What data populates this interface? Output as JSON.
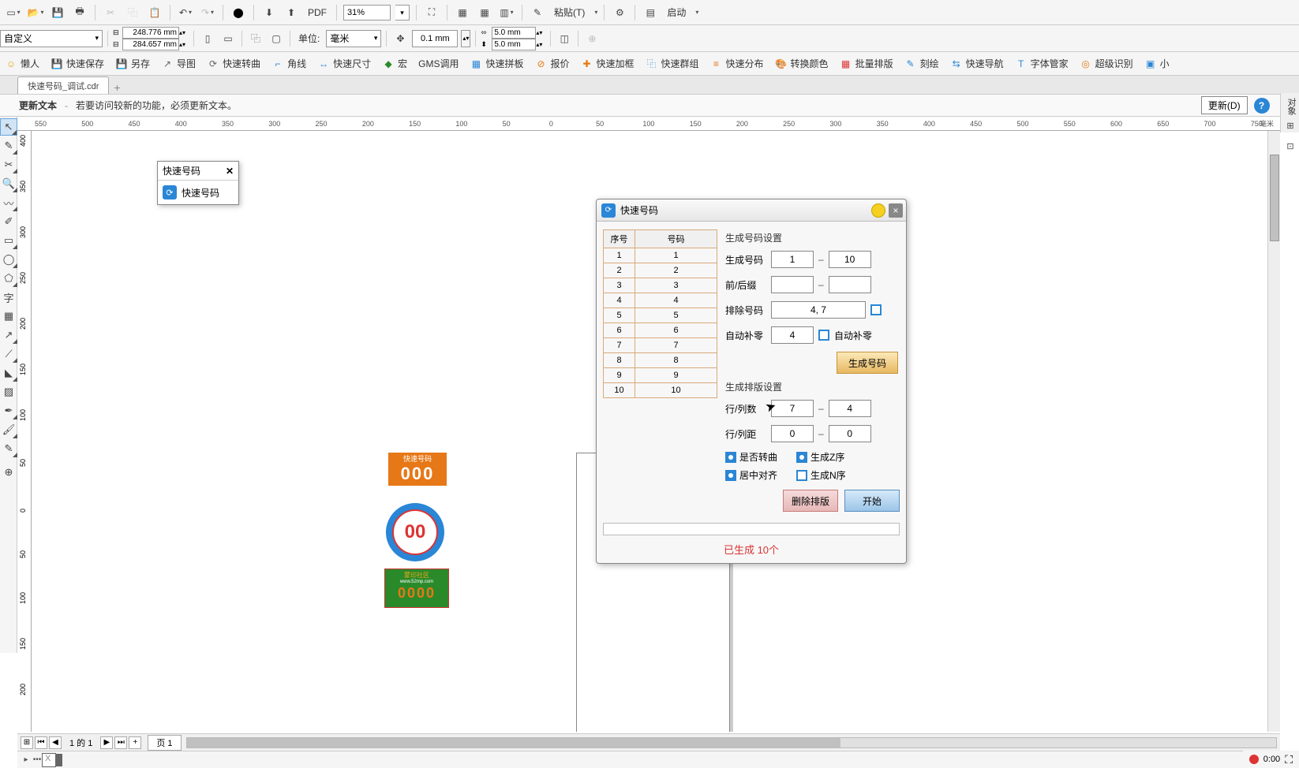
{
  "toolbar1": {
    "pdf_label": "PDF",
    "zoom_value": "31%",
    "paste_label": "粘贴(T)",
    "launch_label": "启动"
  },
  "toolbar2": {
    "preset": "自定义",
    "width": "248.776 mm",
    "height": "284.657 mm",
    "unit_label": "单位:",
    "unit_value": "毫米",
    "nudge": "0.1 mm",
    "dup_x": "5.0 mm",
    "dup_y": "5.0 mm"
  },
  "plugins": {
    "p1": "懒人",
    "p2": "快速保存",
    "p3": "另存",
    "p4": "导图",
    "p5": "快速转曲",
    "p6": "角线",
    "p7": "快速尺寸",
    "p8": "宏",
    "p9": "GMS调用",
    "p10": "快速拼板",
    "p11": "报价",
    "p12": "快速加框",
    "p13": "快速群组",
    "p14": "快速分布",
    "p15": "转换颜色",
    "p16": "批量排版",
    "p17": "刻绘",
    "p18": "快速导航",
    "p19": "字体管家",
    "p20": "超级识别",
    "p21": "小"
  },
  "doc_tab": "快速号码_调试.cdr",
  "info_bar": {
    "title": "更新文本",
    "msg": "若要访问较新的功能，必须更新文本。",
    "update_btn": "更新(D)"
  },
  "right_panel": "对象",
  "ruler_unit": "毫米",
  "ruler_h_ticks": [
    "-550",
    "-500",
    "-450",
    "-400",
    "-350",
    "-300",
    "-250",
    "-200",
    "-150",
    "-100",
    "-50",
    "0",
    "50",
    "100",
    "150",
    "200",
    "250",
    "300",
    "350",
    "400",
    "450",
    "500",
    "550",
    "600",
    "650",
    "700",
    "750"
  ],
  "ruler_v_ticks": [
    "400",
    "350",
    "300",
    "250",
    "200",
    "150",
    "100",
    "50",
    "0",
    "-50",
    "-100",
    "-150",
    "-200"
  ],
  "badges": {
    "b1_title": "快速号码",
    "b1_num": "000",
    "b2_num": "00",
    "b3_title": "蒙印社区",
    "b3_url": "www.52mp.com",
    "b3_num": "0000"
  },
  "docker1": {
    "title": "快速号码",
    "item": "快速号码"
  },
  "dialog": {
    "title": "快速号码",
    "table_header_index": "序号",
    "table_header_num": "号码",
    "rows": [
      {
        "i": "1",
        "n": "1"
      },
      {
        "i": "2",
        "n": "2"
      },
      {
        "i": "3",
        "n": "3"
      },
      {
        "i": "4",
        "n": "4"
      },
      {
        "i": "5",
        "n": "5"
      },
      {
        "i": "6",
        "n": "6"
      },
      {
        "i": "7",
        "n": "7"
      },
      {
        "i": "8",
        "n": "8"
      },
      {
        "i": "9",
        "n": "9"
      },
      {
        "i": "10",
        "n": "10"
      }
    ],
    "section1": "生成号码设置",
    "gen_label": "生成号码",
    "gen_from": "1",
    "gen_to": "10",
    "prefix_label": "前/后缀",
    "prefix_from": "",
    "prefix_to": "",
    "exclude_label": "排除号码",
    "exclude_value": "4, 7",
    "pad_label": "自动补零",
    "pad_value": "4",
    "pad_check": "自动补零",
    "gen_btn": "生成号码",
    "section2": "生成排版设置",
    "rowcol_label": "行/列数",
    "rows_v": "7",
    "cols_v": "4",
    "gap_label": "行/列距",
    "gap_r": "0",
    "gap_c": "0",
    "check1": "是否转曲",
    "check2": "生成Z序",
    "check3": "居中对齐",
    "check4": "生成N序",
    "del_btn": "删除排版",
    "start_btn": "开始",
    "status": "已生成 10个"
  },
  "page_nav": {
    "page_text": "1 的 1",
    "tab": "页 1"
  },
  "palette": {
    "colors": [
      "#00aeef",
      "#ec008c",
      "#fff200",
      "#000000",
      "#ed1c24",
      "#00a651",
      "#f7941d",
      "#8dc63f"
    ]
  },
  "status": {
    "time": "0:00"
  }
}
